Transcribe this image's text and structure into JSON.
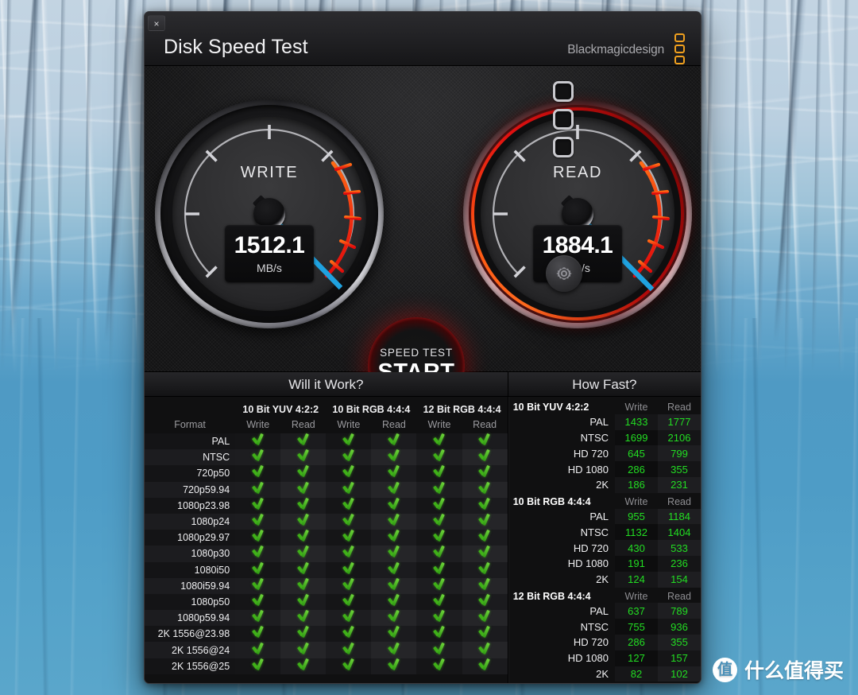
{
  "window": {
    "title": "Disk Speed Test",
    "close_label": "×",
    "brand": "Blackmagicdesign",
    "brand_accent": "#f0a01e"
  },
  "gauges": [
    {
      "name": "write",
      "label": "WRITE",
      "value": "1512.1",
      "unit": "MB/s",
      "needle_color": "#1fa2e0",
      "highlight": false
    },
    {
      "name": "read",
      "label": "READ",
      "value": "1884.1",
      "unit": "MB/s",
      "needle_color": "#1fa2e0",
      "highlight": true
    }
  ],
  "controls": {
    "start_small": "SPEED TEST",
    "start_big": "START",
    "gear_icon": "gear-icon",
    "leds": 3
  },
  "will_it_work": {
    "title": "Will it Work?",
    "groups": [
      "10 Bit YUV 4:2:2",
      "10 Bit RGB 4:4:4",
      "12 Bit RGB 4:4:4"
    ],
    "sub_headers": [
      "Write",
      "Read"
    ],
    "format_header": "Format",
    "check_glyph": "check-icon",
    "rows": [
      {
        "format": "PAL",
        "checks": [
          true,
          true,
          true,
          true,
          true,
          true
        ]
      },
      {
        "format": "NTSC",
        "checks": [
          true,
          true,
          true,
          true,
          true,
          true
        ]
      },
      {
        "format": "720p50",
        "checks": [
          true,
          true,
          true,
          true,
          true,
          true
        ]
      },
      {
        "format": "720p59.94",
        "checks": [
          true,
          true,
          true,
          true,
          true,
          true
        ]
      },
      {
        "format": "1080p23.98",
        "checks": [
          true,
          true,
          true,
          true,
          true,
          true
        ]
      },
      {
        "format": "1080p24",
        "checks": [
          true,
          true,
          true,
          true,
          true,
          true
        ]
      },
      {
        "format": "1080p29.97",
        "checks": [
          true,
          true,
          true,
          true,
          true,
          true
        ]
      },
      {
        "format": "1080p30",
        "checks": [
          true,
          true,
          true,
          true,
          true,
          true
        ]
      },
      {
        "format": "1080i50",
        "checks": [
          true,
          true,
          true,
          true,
          true,
          true
        ]
      },
      {
        "format": "1080i59.94",
        "checks": [
          true,
          true,
          true,
          true,
          true,
          true
        ]
      },
      {
        "format": "1080p50",
        "checks": [
          true,
          true,
          true,
          true,
          true,
          true
        ]
      },
      {
        "format": "1080p59.94",
        "checks": [
          true,
          true,
          true,
          true,
          true,
          true
        ]
      },
      {
        "format": "2K 1556@23.98",
        "checks": [
          true,
          true,
          true,
          true,
          true,
          true
        ]
      },
      {
        "format": "2K 1556@24",
        "checks": [
          true,
          true,
          true,
          true,
          true,
          true
        ]
      },
      {
        "format": "2K 1556@25",
        "checks": [
          true,
          true,
          true,
          true,
          true,
          true
        ]
      }
    ]
  },
  "how_fast": {
    "title": "How Fast?",
    "col_write": "Write",
    "col_read": "Read",
    "value_color": "#22dd22",
    "sections": [
      {
        "name": "10 Bit YUV 4:2:2",
        "rows": [
          {
            "label": "PAL",
            "write": "1433",
            "read": "1777"
          },
          {
            "label": "NTSC",
            "write": "1699",
            "read": "2106"
          },
          {
            "label": "HD 720",
            "write": "645",
            "read": "799"
          },
          {
            "label": "HD 1080",
            "write": "286",
            "read": "355"
          },
          {
            "label": "2K",
            "write": "186",
            "read": "231"
          }
        ]
      },
      {
        "name": "10 Bit RGB 4:4:4",
        "rows": [
          {
            "label": "PAL",
            "write": "955",
            "read": "1184"
          },
          {
            "label": "NTSC",
            "write": "1132",
            "read": "1404"
          },
          {
            "label": "HD 720",
            "write": "430",
            "read": "533"
          },
          {
            "label": "HD 1080",
            "write": "191",
            "read": "236"
          },
          {
            "label": "2K",
            "write": "124",
            "read": "154"
          }
        ]
      },
      {
        "name": "12 Bit RGB 4:4:4",
        "rows": [
          {
            "label": "PAL",
            "write": "637",
            "read": "789"
          },
          {
            "label": "NTSC",
            "write": "755",
            "read": "936"
          },
          {
            "label": "HD 720",
            "write": "286",
            "read": "355"
          },
          {
            "label": "HD 1080",
            "write": "127",
            "read": "157"
          },
          {
            "label": "2K",
            "write": "82",
            "read": "102"
          }
        ]
      }
    ]
  },
  "watermark": {
    "logo": "值",
    "text": "什么值得买"
  }
}
